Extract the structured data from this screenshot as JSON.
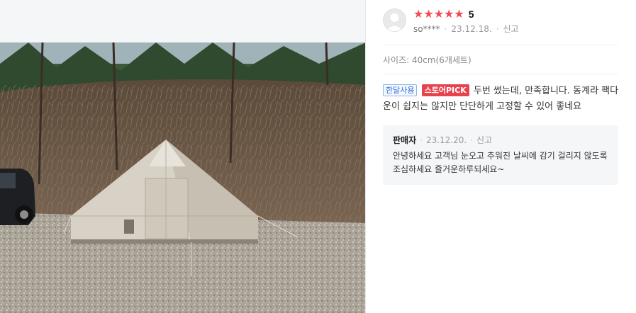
{
  "review": {
    "rating": "5",
    "stars": [
      "★",
      "★",
      "★",
      "★",
      "★"
    ],
    "user": "so****",
    "date": "23.12.18.",
    "report": "신고",
    "option": "사이즈: 40cm(6개세트)",
    "badges": {
      "monthly": "한달사용",
      "store_pick": "스토어PICK"
    },
    "text": " 두번 썼는데, 만족합니다. 동계라 팩다운이 쉽지는 않지만 단단하게 고정할 수 있어 좋네요"
  },
  "seller_reply": {
    "name": "판매자",
    "date": "23.12.20.",
    "report": "신고",
    "text": "안녕하세요  고객님   눈오고 추워진 날씨에 감기 걸리지 않도록 조심하세요 즐거운하루되세요~"
  },
  "colors": {
    "star": "#f04a54",
    "badge_red": "#e8424d",
    "badge_blue": "#2f6fd6",
    "seller_bg": "#f5f6f8"
  },
  "icons": {
    "avatar": "default-user-avatar-icon",
    "star": "star-icon"
  }
}
